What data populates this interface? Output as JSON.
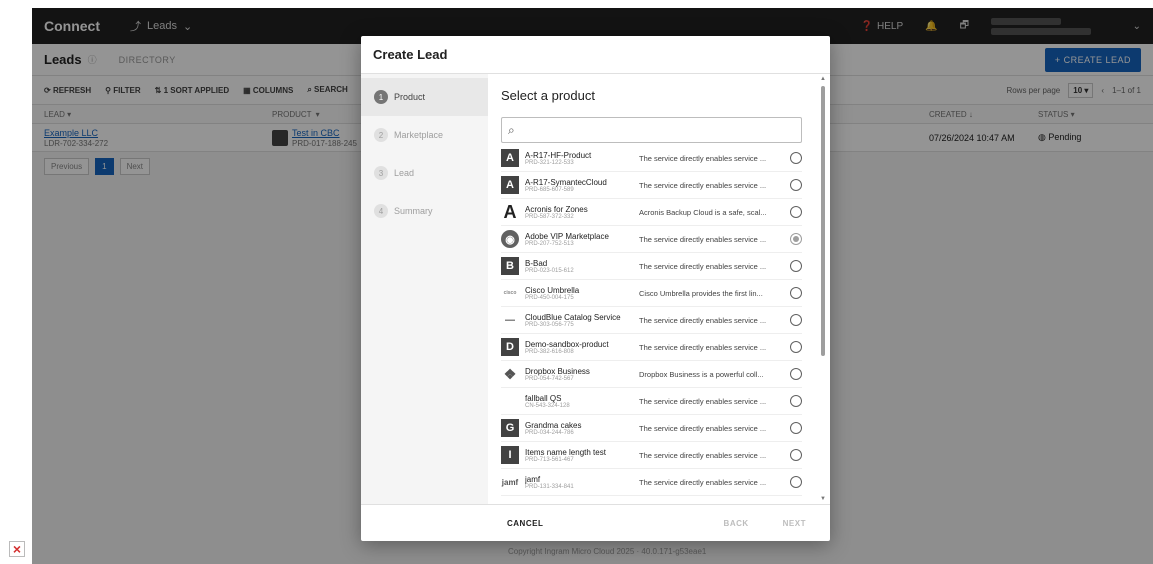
{
  "app": {
    "brand": "Connect",
    "module": "Leads",
    "help_label": "HELP"
  },
  "page": {
    "title": "Leads",
    "directory_tab": "DIRECTORY",
    "create_button": "+ CREATE LEAD"
  },
  "toolbar": {
    "refresh": "REFRESH",
    "filter": "FILTER",
    "sort": "1 SORT APPLIED",
    "columns": "COLUMNS",
    "search": "SEARCH",
    "rows_per_page_label": "Rows per page",
    "rows_per_page": "10",
    "range": "1–1 of 1"
  },
  "table": {
    "headers": {
      "lead": "LEAD",
      "product": "PRODUCT",
      "created": "CREATED",
      "status": "STATUS"
    },
    "rows": [
      {
        "lead_name": "Example LLC",
        "lead_id": "LDR-702-334-272",
        "product_name": "Test in CBC",
        "product_id": "PRD-017-188-245",
        "created": "07/26/2024 10:47 AM",
        "status": "Pending"
      }
    ],
    "pager": {
      "previous": "Previous",
      "page": "1",
      "next": "Next"
    }
  },
  "footer": {
    "copyright": "Copyright Ingram Micro Cloud 2025 · 40.0.171-g53eae1"
  },
  "modal": {
    "title": "Create Lead",
    "steps": [
      {
        "num": "1",
        "label": "Product"
      },
      {
        "num": "2",
        "label": "Marketplace"
      },
      {
        "num": "3",
        "label": "Lead"
      },
      {
        "num": "4",
        "label": "Summary"
      }
    ],
    "content_title": "Select a product",
    "search_placeholder": "",
    "products": [
      {
        "logo": "A",
        "name": "A-R17-HF-Product",
        "id": "PRD-321-122-533",
        "desc": "The service directly enables service ...",
        "selected": false
      },
      {
        "logo": "A",
        "name": "A-R17-SymantecCloud",
        "id": "PRD-685-607-589",
        "desc": "The service directly enables service ...",
        "selected": false
      },
      {
        "logo": "A",
        "name": "Acronis for Zones",
        "id": "PRD-587-372-332",
        "desc": "Acronis Backup Cloud is a safe, scal...",
        "selected": false
      },
      {
        "logo": "",
        "name": "Adobe VIP Marketplace",
        "id": "PRD-207-752-513",
        "desc": "The service directly enables service ...",
        "selected": true
      },
      {
        "logo": "B",
        "name": "B-Bad",
        "id": "PRD-023-015-612",
        "desc": "The service directly enables service ...",
        "selected": false
      },
      {
        "logo": "",
        "name": "Cisco Umbrella",
        "id": "PRD-450-004-175",
        "desc": "Cisco Umbrella provides the first lin...",
        "selected": false
      },
      {
        "logo": "",
        "name": "CloudBlue Catalog Service",
        "id": "PRD-303-056-775",
        "desc": "The service directly enables service ...",
        "selected": false
      },
      {
        "logo": "D",
        "name": "Demo-sandbox-product",
        "id": "PRD-382-616-808",
        "desc": "The service directly enables service ...",
        "selected": false
      },
      {
        "logo": "",
        "name": "Dropbox Business",
        "id": "PRD-054-742-567",
        "desc": "Dropbox Business is a powerful coll...",
        "selected": false
      },
      {
        "logo": "",
        "name": "fallball QS",
        "id": "CN-543-324-128",
        "desc": "The service directly enables service ...",
        "selected": false
      },
      {
        "logo": "G",
        "name": "Grandma cakes",
        "id": "PRD-034-244-786",
        "desc": "The service directly enables service ...",
        "selected": false
      },
      {
        "logo": "I",
        "name": "Items name length test",
        "id": "PRD-713-561-467",
        "desc": "The service directly enables service ...",
        "selected": false
      },
      {
        "logo": "jamf",
        "name": "jamf",
        "id": "PRD-131-334-841",
        "desc": "The service directly enables service ...",
        "selected": false
      }
    ],
    "buttons": {
      "cancel": "CANCEL",
      "back": "BACK",
      "next": "NEXT"
    }
  }
}
